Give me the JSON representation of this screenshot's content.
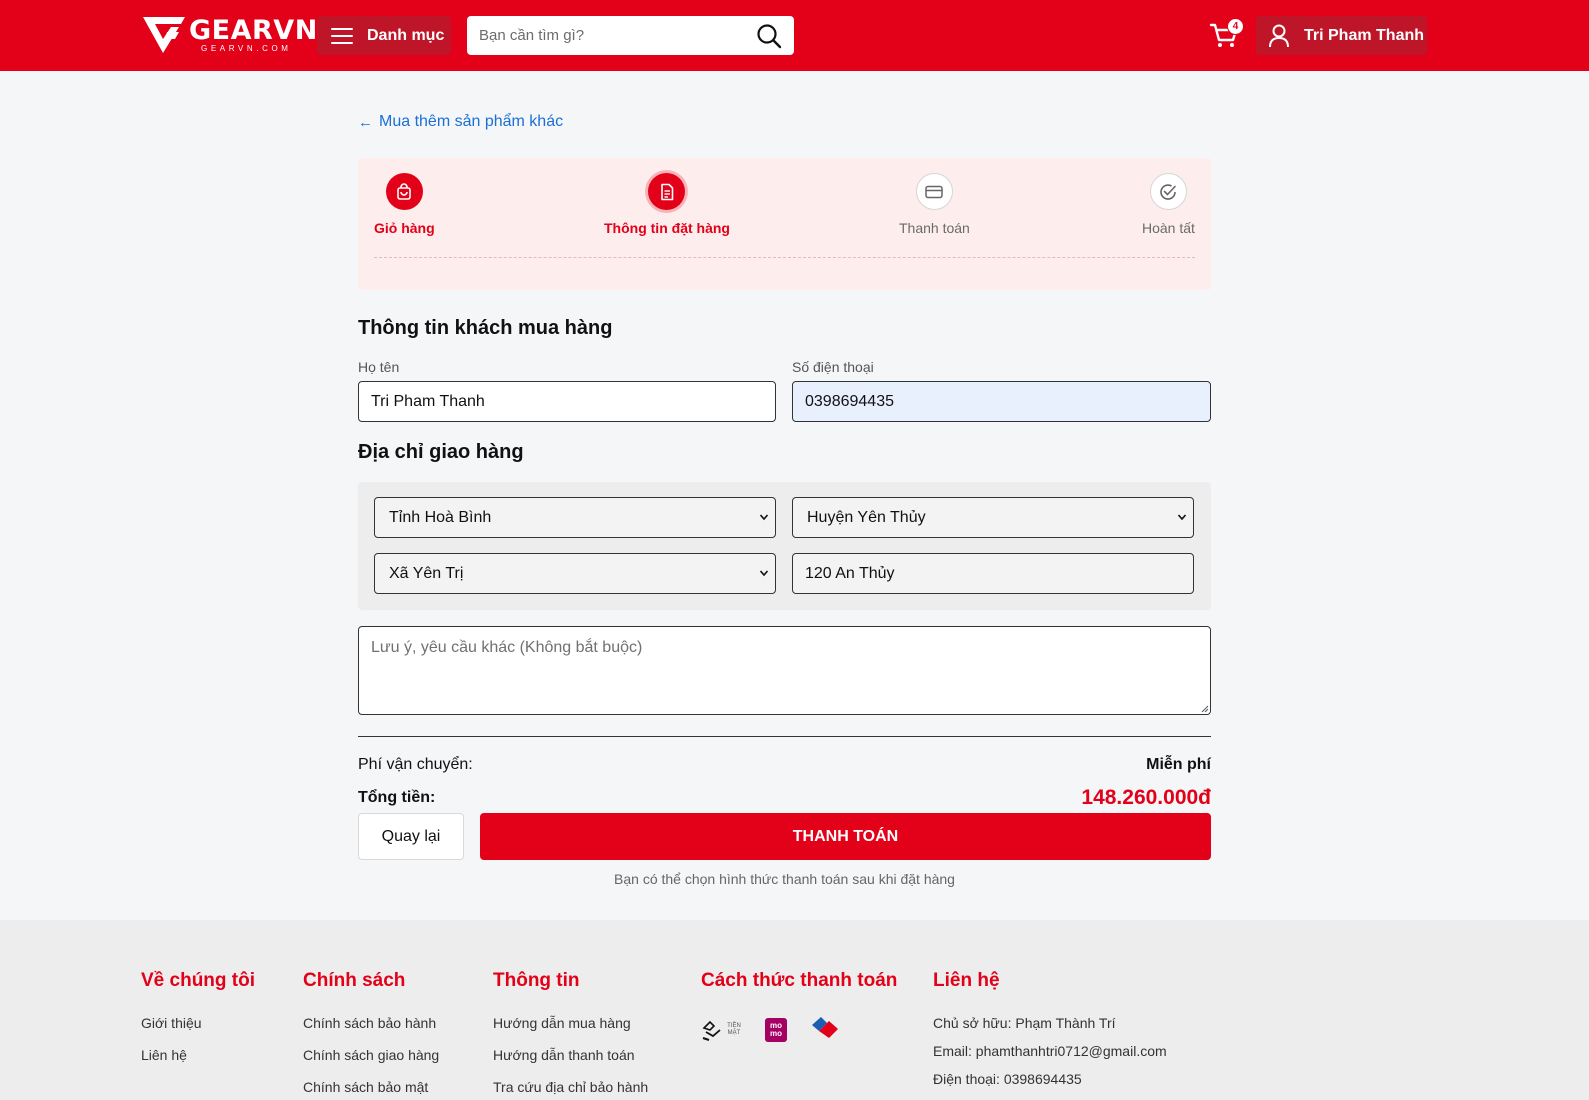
{
  "header": {
    "logo_text": "GEARVN",
    "logo_sub": "GEARVN.COM",
    "menu_label": "Danh mục",
    "search_placeholder": "Bạn cần tìm gì?",
    "cart_count": "4",
    "user_name": "Tri Pham Thanh",
    "brand_color": "#e30019"
  },
  "back_link": "Mua thêm sản phẩm khác",
  "steps": [
    {
      "label": "Giỏ hàng",
      "icon": "shopping-bag-icon",
      "state": "done"
    },
    {
      "label": "Thông tin đặt hàng",
      "icon": "document-icon",
      "state": "current"
    },
    {
      "label": "Thanh toán",
      "icon": "credit-card-icon",
      "state": "pending"
    },
    {
      "label": "Hoàn tất",
      "icon": "check-circle-icon",
      "state": "pending"
    }
  ],
  "customer": {
    "title": "Thông tin khách mua hàng",
    "name_label": "Họ tên",
    "name_value": "Tri Pham Thanh",
    "phone_label": "Số điện thoại",
    "phone_value": "0398694435"
  },
  "address": {
    "title": "Địa chỉ giao hàng",
    "province": "Tỉnh Hoà Bình",
    "district": "Huyện Yên Thủy",
    "ward": "Xã Yên Trị",
    "street": "120 An Thủy",
    "note_placeholder": "Lưu ý, yêu cầu khác (Không bắt buộc)"
  },
  "summary": {
    "shipping_label": "Phí vận chuyển:",
    "shipping_value": "Miễn phí",
    "total_label": "Tổng tiền:",
    "total_value": "148.260.000đ",
    "back_button": "Quay lại",
    "pay_button": "THANH TOÁN",
    "hint": "Bạn có thể chọn hình thức thanh toán sau khi đặt hàng"
  },
  "footer": {
    "about": {
      "title": "Về chúng tôi",
      "links": [
        "Giới thiệu",
        "Liên hệ"
      ]
    },
    "policy": {
      "title": "Chính sách",
      "links": [
        "Chính sách bảo hành",
        "Chính sách giao hàng",
        "Chính sách bảo mật"
      ]
    },
    "info": {
      "title": "Thông tin",
      "links": [
        "Hướng dẫn mua hàng",
        "Hướng dẫn thanh toán",
        "Tra cứu địa chỉ bảo hành"
      ]
    },
    "payment": {
      "title": "Cách thức thanh toán",
      "icons": [
        "cash-icon",
        "momo-icon",
        "vnpay-icon"
      ],
      "cash_text": "TIỀN MẶT",
      "momo_text": "mo mo"
    },
    "contact": {
      "title": "Liên hệ",
      "owner": "Chủ sở hữu: Phạm Thành Trí",
      "email": "Email: phamthanhtri0712@gmail.com",
      "phone": "Điện thoại: 0398694435"
    }
  }
}
